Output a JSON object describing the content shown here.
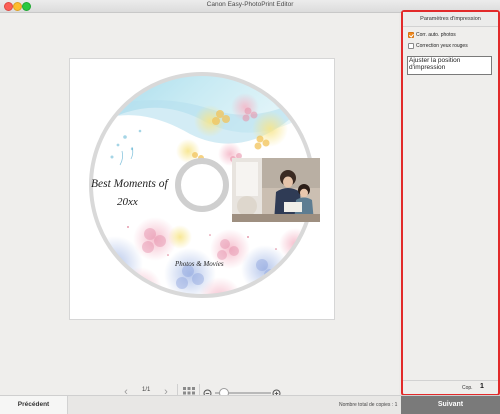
{
  "window": {
    "title": "Canon Easy-PhotoPrint Editor"
  },
  "disc": {
    "title": "Best Moments of",
    "year": "20xx",
    "subtitle": "Photos & Movies"
  },
  "navigation": {
    "page_indicator": "1/1",
    "prev_icon": "chevron-left-icon",
    "next_icon": "chevron-right-icon",
    "grid_icon": "grid-view-icon",
    "zoom_out_icon": "zoom-out-icon",
    "zoom_in_icon": "zoom-in-icon",
    "zoom_level": 0.1
  },
  "sidebar": {
    "header": "Paramètres d'impression",
    "auto_correct": {
      "label": "Corr. auto. photos",
      "checked": true
    },
    "red_eye": {
      "label": "Correction yeux rouges",
      "checked": false
    },
    "adjust_button": "Ajuster la position d'impression",
    "copies_label": "Cop.",
    "copies_value": "1"
  },
  "footer": {
    "prev_label": "Précédent",
    "total_copies": "Nombre total de copies : 1",
    "next_label": "Suivant"
  },
  "colors": {
    "accent_border": "#e22a2a",
    "checkbox_orange": "#f0891e",
    "next_button": "#7a7a7a"
  }
}
